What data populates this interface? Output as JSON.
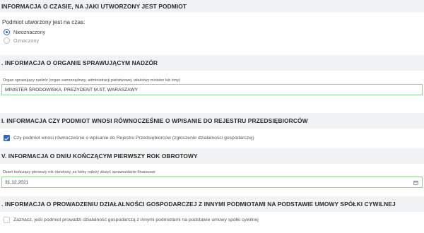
{
  "sections": {
    "s1": {
      "title": "INFORMACJA O CZASIE, NA JAKI UTWORZONY JEST PODMIOT",
      "question": "Podmiot utworzony jest na czas:",
      "options": [
        "Nieoznaczony",
        "Oznaczony"
      ],
      "selected": "Nieoznaczony"
    },
    "s2": {
      "title": ". INFORMACJA O ORGANIE SPRAWUJĄCYM NADZÓR",
      "field_label": "Organ sprawujący nadzór (organ samorządowy, administracji państwowej, właściwy minister lub inny)",
      "field_value": "MINISTER ŚRODOWISKA, PREZYDENT M.ST. WARASZAWY"
    },
    "s3": {
      "title": "I. INFORMACJA CZY PODMIOT WNOSI RÓWNOCZEŚNIE O WPISANIE DO REJESTRU PRZEDSIĘBIORCÓW",
      "checkbox_label": "Czy podmiot wnosi równocześnie o wpisanie do Rejestru Przedsiębiorców (zgłoszenie działalności gospodarczej)",
      "checked": true
    },
    "s4": {
      "title": "V. INFORMACJA O DNIU KOŃCZĄCYM PIERWSZY ROK OBROTOWY",
      "field_label": "Dzień kończący pierwszy rok obrotowy, za który należy złożyć sprawozdanie finansowe",
      "field_value": "31.12.2021",
      "icon": "calendar-icon"
    },
    "s5": {
      "title": ". INFORMACJA O PROWADZENIU DZIAŁALNOŚCI GOSPODARCZEJ Z INNYMI PODMIOTAMI NA PODSTAWIE UMOWY SPÓŁKI CYWILNEJ",
      "checkbox_label": "Zaznacz, jeśli podmiot prowadzi działalność gospodarczą z innymi podmiotami na podstawie umowy spółki cywilnej",
      "checked": false
    }
  },
  "colors": {
    "header_bg": "#f1f2f4",
    "accent": "#2c66c6",
    "valid_border": "#8fd39b"
  }
}
